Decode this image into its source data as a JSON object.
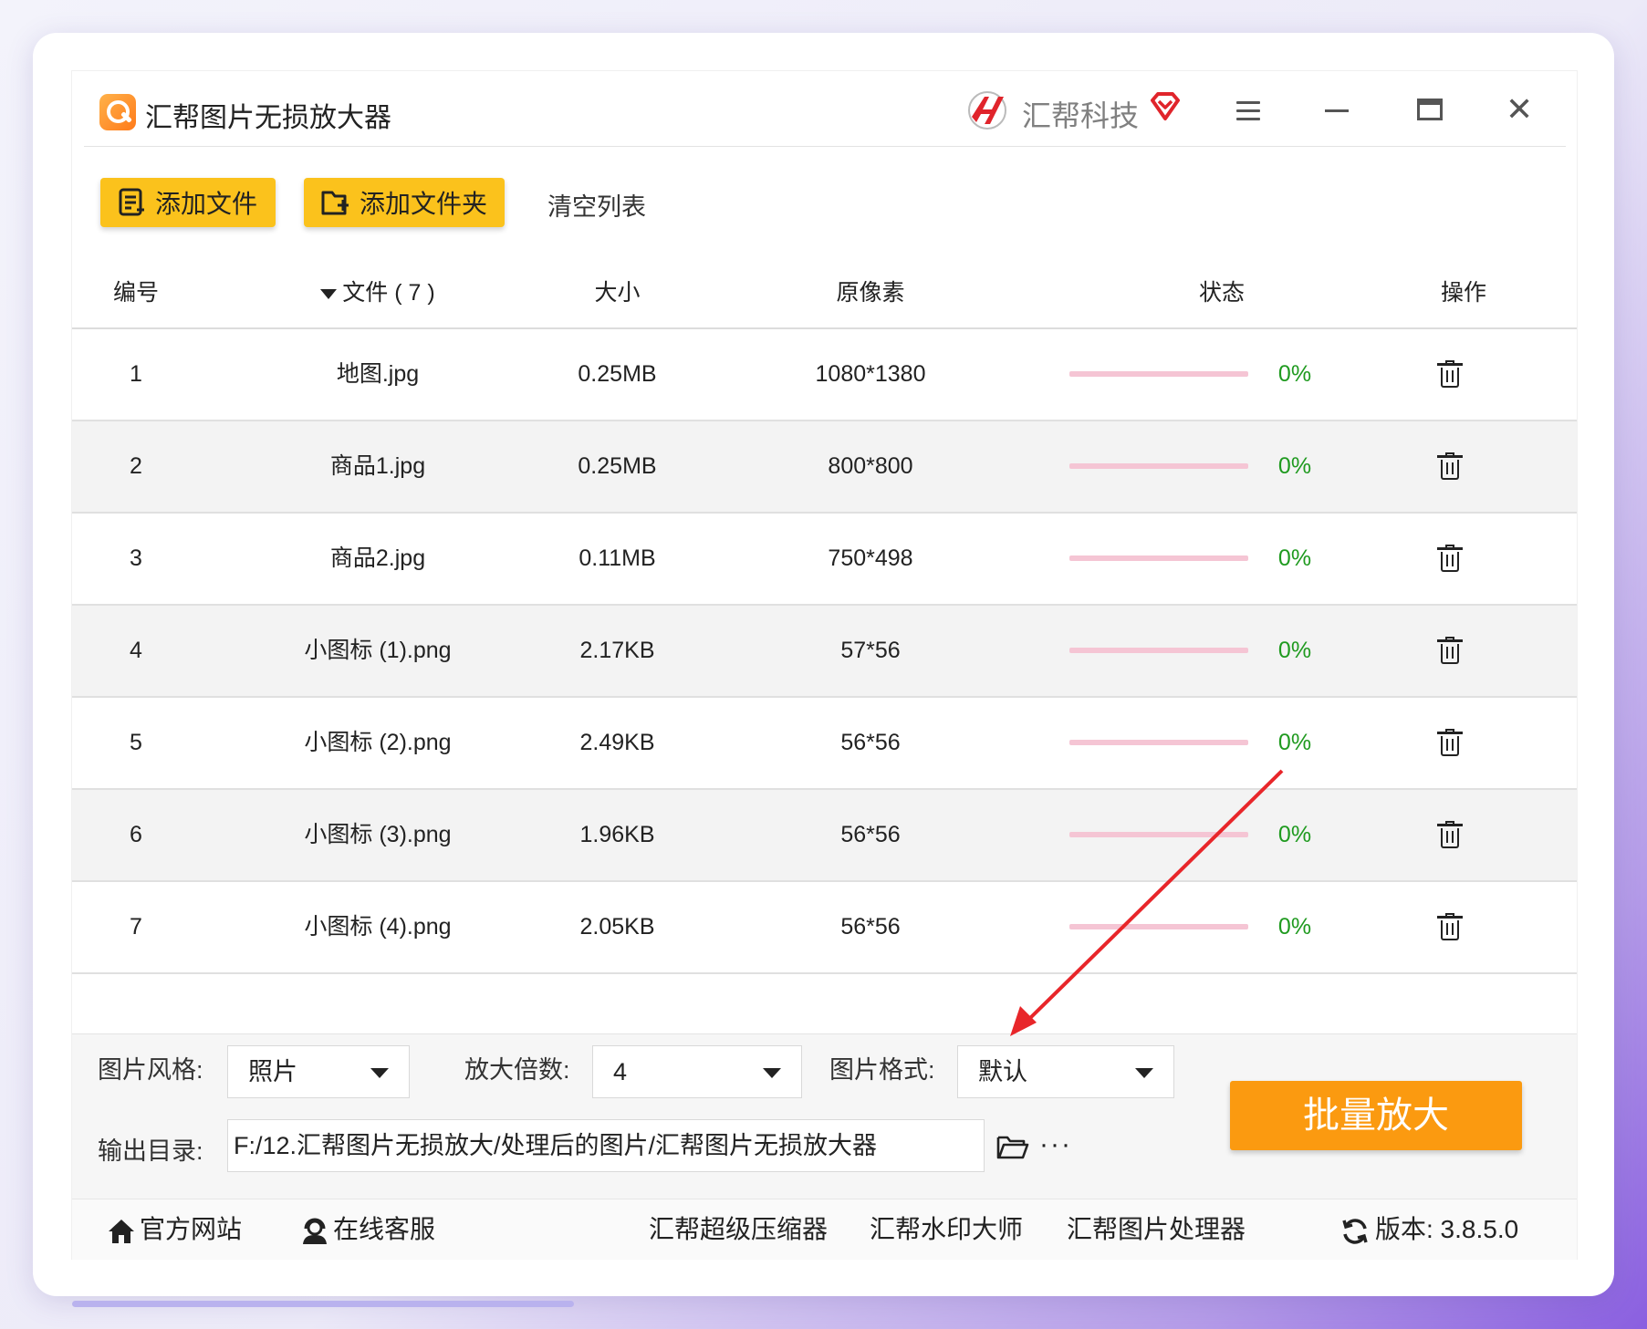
{
  "app": {
    "title": "汇帮图片无损放大器",
    "brand": "汇帮科技"
  },
  "toolbar": {
    "add_file": "添加文件",
    "add_folder": "添加文件夹",
    "clear_list": "清空列表"
  },
  "table": {
    "headers": {
      "no": "编号",
      "file": "文件 ( 7 )",
      "size": "大小",
      "pixels": "原像素",
      "state": "状态",
      "op": "操作"
    },
    "rows": [
      {
        "no": "1",
        "file": "地图.jpg",
        "size": "0.25MB",
        "pixels": "1080*1380",
        "progress": "0%",
        "progress_value": 0
      },
      {
        "no": "2",
        "file": "商品1.jpg",
        "size": "0.25MB",
        "pixels": "800*800",
        "progress": "0%",
        "progress_value": 0
      },
      {
        "no": "3",
        "file": "商品2.jpg",
        "size": "0.11MB",
        "pixels": "750*498",
        "progress": "0%",
        "progress_value": 0
      },
      {
        "no": "4",
        "file": "小图标 (1).png",
        "size": "2.17KB",
        "pixels": "57*56",
        "progress": "0%",
        "progress_value": 0
      },
      {
        "no": "5",
        "file": "小图标 (2).png",
        "size": "2.49KB",
        "pixels": "56*56",
        "progress": "0%",
        "progress_value": 0
      },
      {
        "no": "6",
        "file": "小图标 (3).png",
        "size": "1.96KB",
        "pixels": "56*56",
        "progress": "0%",
        "progress_value": 0
      },
      {
        "no": "7",
        "file": "小图标 (4).png",
        "size": "2.05KB",
        "pixels": "56*56",
        "progress": "0%",
        "progress_value": 0
      }
    ]
  },
  "settings": {
    "style_label": "图片风格:",
    "style_value": "照片",
    "scale_label": "放大倍数:",
    "scale_value": "4",
    "format_label": "图片格式:",
    "format_value": "默认",
    "output_label": "输出目录:",
    "output_path": "F:/12.汇帮图片无损放大/处理后的图片/汇帮图片无损放大器",
    "more": "···",
    "start_button": "批量放大"
  },
  "footer": {
    "website": "官方网站",
    "support": "在线客服",
    "compressor": "汇帮超级压缩器",
    "watermark": "汇帮水印大师",
    "image_processor": "汇帮图片处理器",
    "version": "版本:  3.8.5.0"
  },
  "colors": {
    "accent_yellow": "#fbc21c",
    "accent_orange": "#fb9a10",
    "progress_bg": "#f5c5d4",
    "percent_green": "#1f9a1f",
    "annotation_red": "#e8262a"
  },
  "icons": {
    "app_logo": "magnifier-icon",
    "brand_logo": "huibang-logo-icon",
    "vip": "diamond-vip-icon",
    "menu": "hamburger-icon",
    "minimize": "minimize-icon",
    "maximize": "maximize-icon",
    "close": "close-icon",
    "add_file": "document-list-icon",
    "add_folder": "folder-plus-icon",
    "delete": "trash-icon",
    "open_folder": "folder-open-icon",
    "home": "home-icon",
    "support": "headset-user-icon",
    "refresh": "refresh-icon"
  }
}
